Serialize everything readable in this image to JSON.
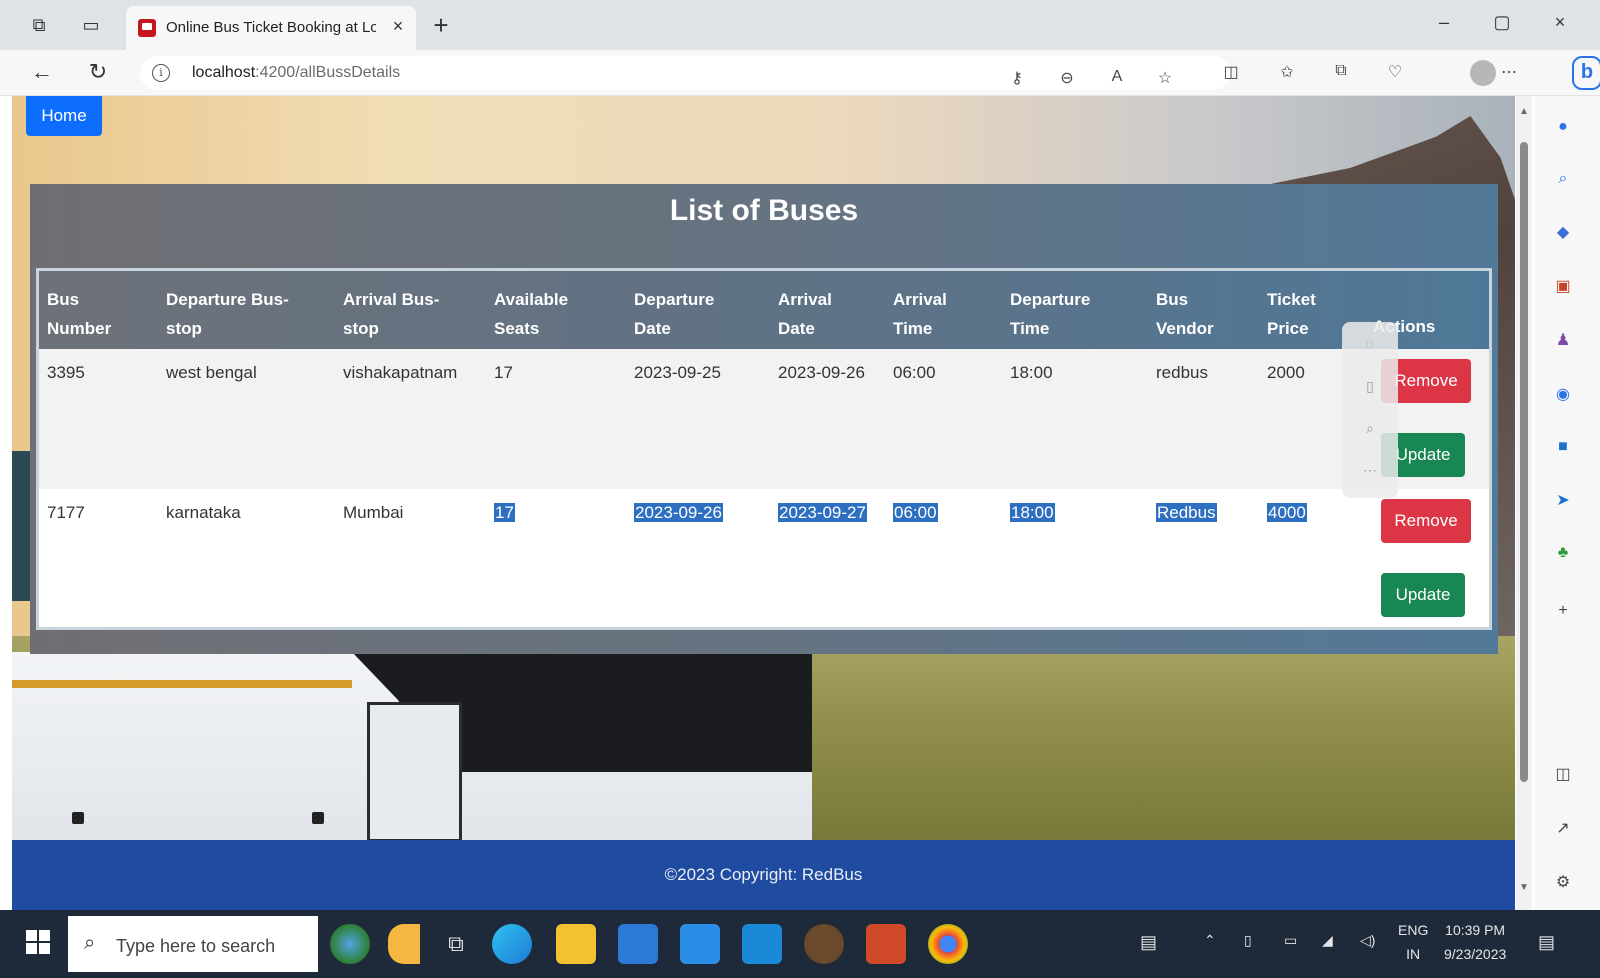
{
  "browser": {
    "tab_title": "Online Bus Ticket Booking at Lo",
    "url_host": "localhost",
    "url_path": ":4200/allBussDetails"
  },
  "page": {
    "home_label": "Home",
    "heading": "List of Buses",
    "footer": "©2023 Copyright: RedBus",
    "table": {
      "headers": [
        {
          "line1": "Bus",
          "line2": "Number"
        },
        {
          "line1": "Departure Bus-",
          "line2": "stop"
        },
        {
          "line1": "Arrival Bus-",
          "line2": "stop"
        },
        {
          "line1": "Available",
          "line2": "Seats"
        },
        {
          "line1": "Departure",
          "line2": "Date"
        },
        {
          "line1": "Arrival",
          "line2": "Date"
        },
        {
          "line1": "Arrival",
          "line2": "Time"
        },
        {
          "line1": "Departure",
          "line2": "Time"
        },
        {
          "line1": "Bus",
          "line2": "Vendor"
        },
        {
          "line1": "Ticket",
          "line2": "Price"
        },
        {
          "line1": "",
          "line2": "Actions"
        }
      ],
      "rows": [
        {
          "bus_number": "3395",
          "departure_stop": "west bengal",
          "arrival_stop": "vishakapatnam",
          "seats": "17",
          "departure_date": "2023-09-25",
          "arrival_date": "2023-09-26",
          "arrival_time": "06:00",
          "departure_time": "18:00",
          "vendor": "redbus",
          "price": "2000"
        },
        {
          "bus_number": "7177",
          "departure_stop": "karnataka",
          "arrival_stop": "Mumbai",
          "seats": "17",
          "departure_date": "2023-09-26",
          "arrival_date": "2023-09-27",
          "arrival_time": "06:00",
          "departure_time": "18:00",
          "vendor": "Redbus",
          "price": "4000"
        }
      ],
      "remove_label": "Remove",
      "update_label": "Update"
    }
  },
  "taskbar": {
    "search_placeholder": "Type here to search",
    "lang_line1": "ENG",
    "lang_line2": "IN",
    "time": "10:39 PM",
    "date": "9/23/2023"
  },
  "colors": {
    "home_button": "#0d6efd",
    "remove_button": "#dc3545",
    "update_button": "#198754",
    "footer": "#1f4ba0",
    "selection": "#2d6fc1"
  }
}
